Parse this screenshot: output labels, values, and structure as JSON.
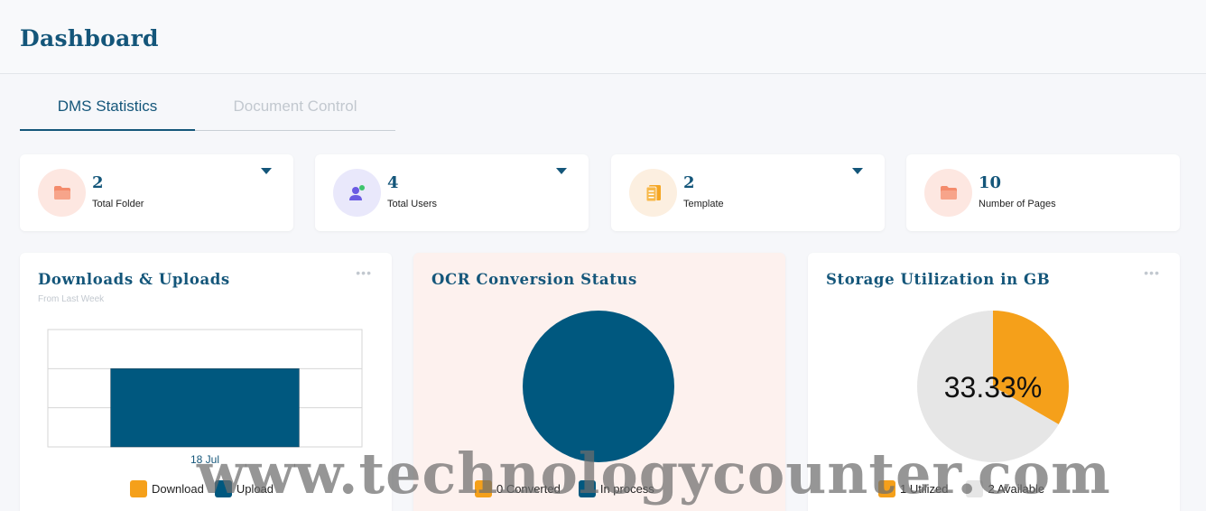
{
  "header": {
    "title": "Dashboard"
  },
  "tabs": [
    {
      "label": "DMS Statistics",
      "active": true
    },
    {
      "label": "Document Control",
      "active": false
    }
  ],
  "stats": [
    {
      "value": "2",
      "label": "Total Folder",
      "icon": "folder-icon",
      "icon_bg": "#fde7e1",
      "icon_color": "#f48b6c",
      "has_dropdown": true
    },
    {
      "value": "4",
      "label": "Total Users",
      "icon": "user-icon",
      "icon_bg": "#e9e8fb",
      "icon_color": "#6a5be2",
      "has_dropdown": true
    },
    {
      "value": "2",
      "label": "Template",
      "icon": "template-icon",
      "icon_bg": "#fcefe0",
      "icon_color": "#f5a623",
      "has_dropdown": true
    },
    {
      "value": "10",
      "label": "Number of Pages",
      "icon": "folder-icon",
      "icon_bg": "#fde7e1",
      "icon_color": "#f48b6c",
      "has_dropdown": false
    }
  ],
  "panels": {
    "downloads": {
      "title": "Downloads & Uploads",
      "subtitle": "From Last Week",
      "menu": "•••"
    },
    "ocr": {
      "title": "OCR Conversion Status"
    },
    "storage": {
      "title": "Storage Utilization in GB",
      "menu": "•••"
    }
  },
  "colors": {
    "primary": "#00587f",
    "orange": "#f5a01a",
    "grey": "#e6e6e6"
  },
  "chart_data": [
    {
      "type": "bar",
      "categories": [
        "18 Jul"
      ],
      "series": [
        {
          "name": "Download",
          "values": [
            0
          ]
        },
        {
          "name": "Upload",
          "values": [
            2
          ]
        }
      ],
      "ylim": [
        0,
        3
      ],
      "legend": "bottom"
    },
    {
      "type": "pie",
      "labels": [
        "Converted",
        "In process"
      ],
      "values": [
        0,
        1
      ],
      "legend_labels": [
        "0  Converted",
        "In process"
      ],
      "legend": "bottom"
    },
    {
      "type": "pie",
      "labels": [
        "Utilized",
        "Available"
      ],
      "values": [
        1,
        2
      ],
      "center_label": "33.33%",
      "legend_labels": [
        "1  Utilized",
        "2  Available"
      ],
      "legend": "bottom"
    }
  ],
  "watermark": "www.technologycounter.com"
}
